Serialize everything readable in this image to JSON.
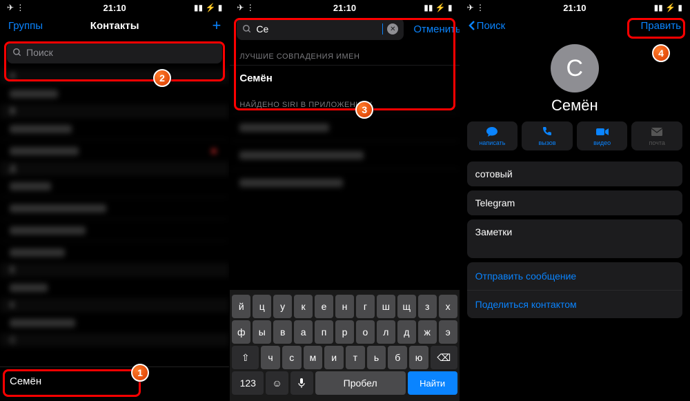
{
  "status": {
    "time": "21:10"
  },
  "p1": {
    "groups": "Группы",
    "title": "Контакты",
    "search_placeholder": "Поиск",
    "target_contact": "Семён"
  },
  "p2": {
    "query": "Се",
    "cancel": "Отменить",
    "section_matches": "ЛУЧШИЕ СОВПАДЕНИЯ ИМЕН",
    "match": "Семён",
    "section_siri": "НАЙДЕНО SIRI В ПРИЛОЖЕНИЯХ",
    "kb_rows": [
      [
        "й",
        "ц",
        "у",
        "к",
        "е",
        "н",
        "г",
        "ш",
        "щ",
        "з",
        "х"
      ],
      [
        "ф",
        "ы",
        "в",
        "а",
        "п",
        "р",
        "о",
        "л",
        "д",
        "ж",
        "э"
      ],
      [
        "ч",
        "с",
        "м",
        "и",
        "т",
        "ь",
        "б",
        "ю"
      ]
    ],
    "kb_123": "123",
    "kb_space": "Пробел",
    "kb_find": "Найти"
  },
  "p3": {
    "back": "Поиск",
    "edit": "Править",
    "initial": "С",
    "name": "Семён",
    "actions": {
      "message": "написать",
      "call": "вызов",
      "video": "видео",
      "mail": "почта"
    },
    "field_mobile": "сотовый",
    "field_im": "Telegram",
    "field_notes": "Заметки",
    "link_send": "Отправить сообщение",
    "link_share": "Поделиться контактом"
  },
  "badges": {
    "b1": "1",
    "b2": "2",
    "b3": "3",
    "b4": "4"
  }
}
